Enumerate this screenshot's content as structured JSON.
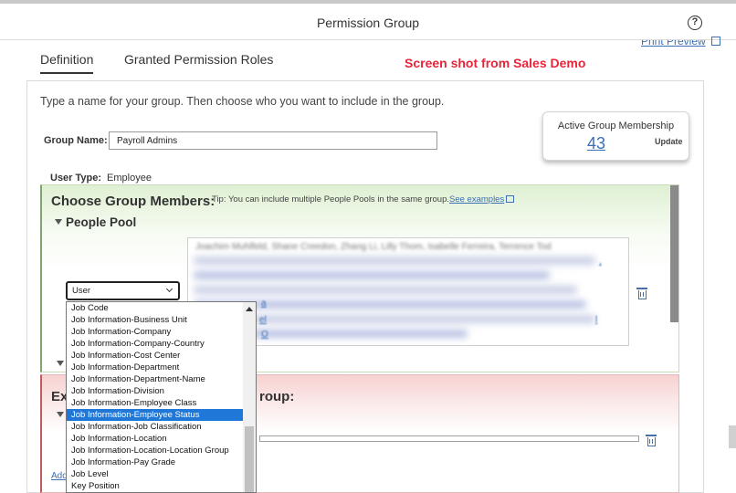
{
  "window": {
    "title": "Permission Group",
    "help_icon": "?"
  },
  "toolbar": {
    "print_preview": "Print Preview"
  },
  "tabs": [
    {
      "label": "Definition",
      "active": true
    },
    {
      "label": "Granted Permission Roles",
      "active": false
    }
  ],
  "annotation": "Screen shot from Sales Demo",
  "intro": "Type a name for your group. Then choose who you want to include in the group.",
  "group_name": {
    "label": "Group Name:",
    "value": "Payroll Admins"
  },
  "membership": {
    "label": "Active Group Membership",
    "count": "43",
    "update_label": "Update"
  },
  "user_type": {
    "label": "User Type:",
    "value": "Employee"
  },
  "choose": {
    "title": "Choose Group Members:",
    "tip": "Tip: You can include multiple People Pools in the same group.",
    "see_examples": "See examples",
    "pool_title": "People Pool",
    "pool_names": "Joachim Muhlfeld,  Shane Creedon,  Zhang Li,  Lilly Thom,  Isabelle Ferreira,  Terrence Tod",
    "frag_a": "a",
    "frag_b": "el",
    "frag_c": "O",
    "frag_d": ",",
    "frag_e": "l"
  },
  "select": {
    "value": "User"
  },
  "dropdown_options": [
    "Job Code",
    "Job Information-Business Unit",
    "Job Information-Company",
    "Job Information-Company-Country",
    "Job Information-Cost Center",
    "Job Information-Department",
    "Job Information-Department-Name",
    "Job Information-Division",
    "Job Information-Employee Class",
    "Job Information-Employee Status",
    "Job Information-Job Classification",
    "Job Information-Location",
    "Job Information-Location-Location Group",
    "Job Information-Pay Grade",
    "Job Level",
    "Key Position"
  ],
  "selected_option": "Job Information-Employee Status",
  "exclude": {
    "title_start": "Ex",
    "title_end": "roup:",
    "add_link": "Add"
  },
  "colors": {
    "link": "#3b6fb6",
    "annotation": "#e8243a",
    "selected": "#1f77d8",
    "include_bg": "#dff0d3",
    "exclude_bg": "#f7d1d1"
  }
}
